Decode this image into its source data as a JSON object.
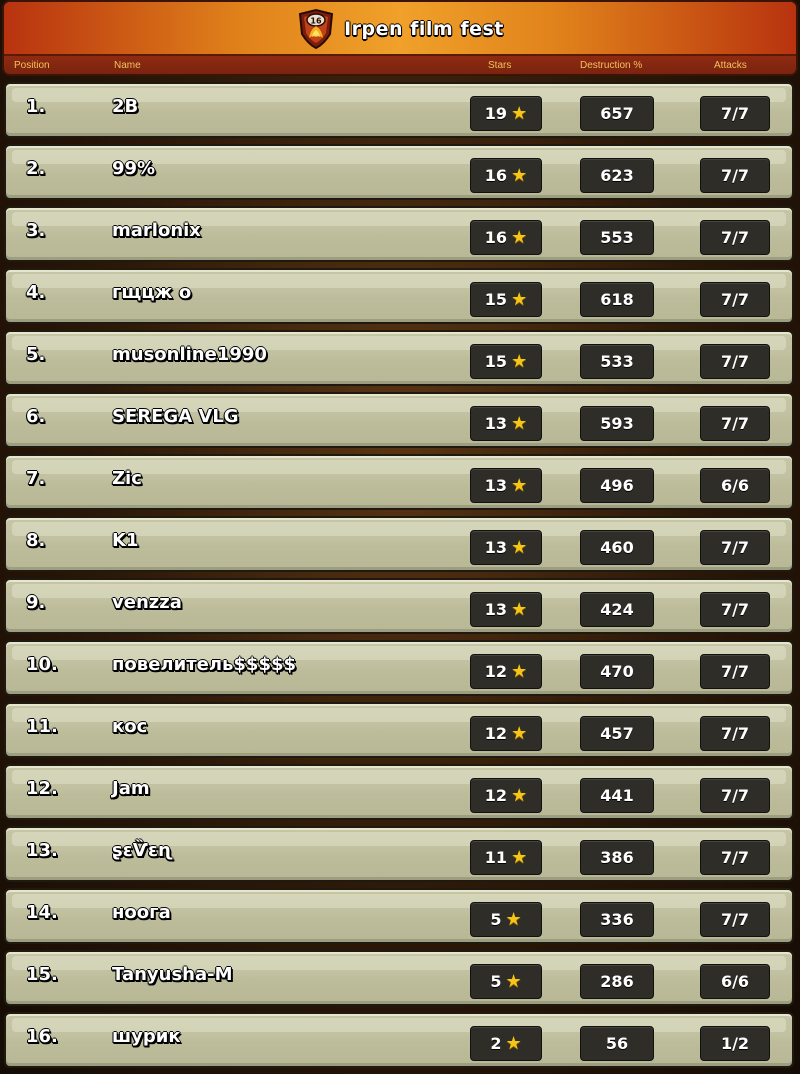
{
  "header": {
    "title": "Irpen film fest",
    "badge_level": "16",
    "columns": {
      "position": "Position",
      "name": "Name",
      "stars": "Stars",
      "destruction": "Destruction %",
      "attacks": "Attacks"
    }
  },
  "icons": {
    "badge": "clan-badge-icon",
    "star": "star-icon"
  },
  "colors": {
    "accent": "#f3c25a",
    "star": "#f5c518",
    "row_bg": "#c2c2a2",
    "box_bg": "#2f2d28"
  },
  "rows": [
    {
      "position": "1.",
      "name": "2B",
      "stars": "19",
      "destruction": "657",
      "attacks": "7/7"
    },
    {
      "position": "2.",
      "name": "99%",
      "stars": "16",
      "destruction": "623",
      "attacks": "7/7"
    },
    {
      "position": "3.",
      "name": "marlonix",
      "stars": "16",
      "destruction": "553",
      "attacks": "7/7"
    },
    {
      "position": "4.",
      "name": "гщцж о",
      "stars": "15",
      "destruction": "618",
      "attacks": "7/7"
    },
    {
      "position": "5.",
      "name": "musonline1990",
      "stars": "15",
      "destruction": "533",
      "attacks": "7/7"
    },
    {
      "position": "6.",
      "name": "SEREGA VLG",
      "stars": "13",
      "destruction": "593",
      "attacks": "7/7"
    },
    {
      "position": "7.",
      "name": "Zic",
      "stars": "13",
      "destruction": "496",
      "attacks": "6/6"
    },
    {
      "position": "8.",
      "name": "K1",
      "stars": "13",
      "destruction": "460",
      "attacks": "7/7"
    },
    {
      "position": "9.",
      "name": "venzza",
      "stars": "13",
      "destruction": "424",
      "attacks": "7/7"
    },
    {
      "position": "10.",
      "name": "повелитель$$$$$",
      "stars": "12",
      "destruction": "470",
      "attacks": "7/7"
    },
    {
      "position": "11.",
      "name": "кос",
      "stars": "12",
      "destruction": "457",
      "attacks": "7/7"
    },
    {
      "position": "12.",
      "name": "Jam",
      "stars": "12",
      "destruction": "441",
      "attacks": "7/7"
    },
    {
      "position": "13.",
      "name": "ʂɛѶɛɳ",
      "stars": "11",
      "destruction": "386",
      "attacks": "7/7"
    },
    {
      "position": "14.",
      "name": "ноога",
      "stars": "5",
      "destruction": "336",
      "attacks": "7/7"
    },
    {
      "position": "15.",
      "name": "Tanyusha-M",
      "stars": "5",
      "destruction": "286",
      "attacks": "6/6"
    },
    {
      "position": "16.",
      "name": "шурик",
      "stars": "2",
      "destruction": "56",
      "attacks": "1/2"
    }
  ]
}
